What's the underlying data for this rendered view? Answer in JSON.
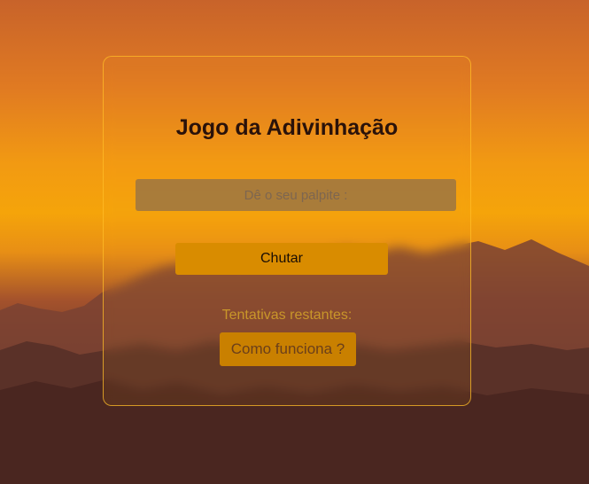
{
  "game": {
    "title": "Jogo da Adivinhação",
    "input_placeholder": "Dê o seu palpite :",
    "guess_button_label": "Chutar",
    "attempts_label": "Tentativas restantes:",
    "how_button_label": "Como funciona ?"
  },
  "colors": {
    "accent": "#d98c00",
    "title_text": "#2a120a",
    "card_border": "#ffbe28"
  }
}
